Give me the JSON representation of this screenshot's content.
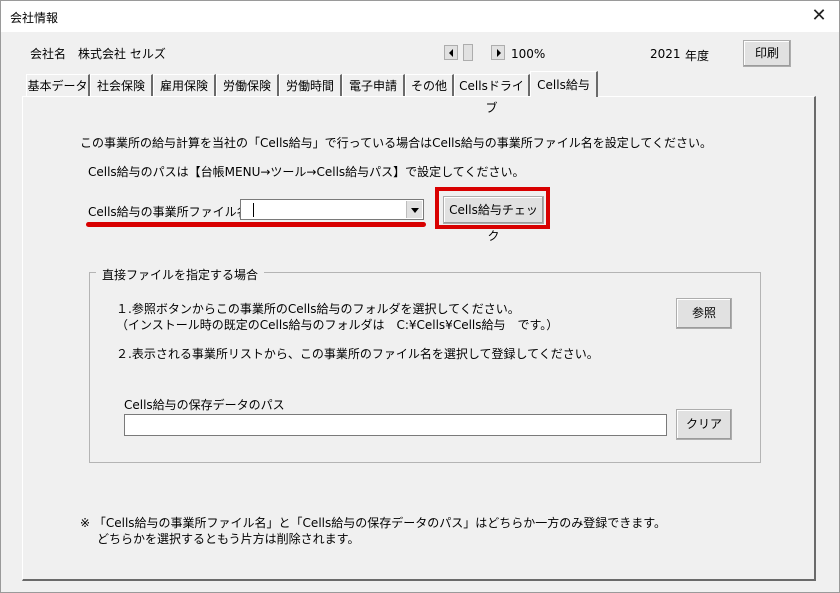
{
  "window": {
    "title": "会社情報",
    "close_icon": "close-icon ✕"
  },
  "header": {
    "company_label": "会社名",
    "company_name": "株式会社 セルズ",
    "zoom": "100%",
    "year": "2021",
    "year_unit": "年度",
    "print_label": "印刷"
  },
  "tabs": [
    {
      "label": "基本データ"
    },
    {
      "label": "社会保険"
    },
    {
      "label": "雇用保険"
    },
    {
      "label": "労働保険"
    },
    {
      "label": "労働時間"
    },
    {
      "label": "電子申請"
    },
    {
      "label": "その他"
    },
    {
      "label": "Cellsドライブ"
    },
    {
      "label": "Cells給与",
      "active": true
    }
  ],
  "main": {
    "intro_line1": "この事業所の給与計算を当社の「Cells給与」で行っている場合はCells給与の事業所ファイル名を設定してください。",
    "intro_line2": "Cells給与のパスは【台帳MENU→ツール→Cells給与パス】で設定してください。",
    "file_label": "Cells給与の事業所ファイル名",
    "file_value": "",
    "check_button": "Cells給与チェック",
    "group_title": "直接ファイルを指定する場合",
    "step1_line1": "１.参照ボタンからこの事業所のCells給与のフォルダを選択してください。",
    "step1_line2": "（インストール時の既定のCells給与のフォルダは　C:¥Cells¥Cells給与　です。）",
    "browse_button": "参照",
    "step2": "２.表示される事業所リストから、この事業所のファイル名を選択して登録してください。",
    "path_label": "Cells給与の保存データのパス",
    "path_value": "",
    "clear_button": "クリア",
    "note_line1": "※ 「Cells給与の事業所ファイル名」と「Cells給与の保存データのパス」はどちらか一方のみ登録できます。",
    "note_line2": "どちらかを選択するともう片方は削除されます。"
  },
  "colors": {
    "highlight": "#d80000",
    "background": "#f0f0f0"
  }
}
